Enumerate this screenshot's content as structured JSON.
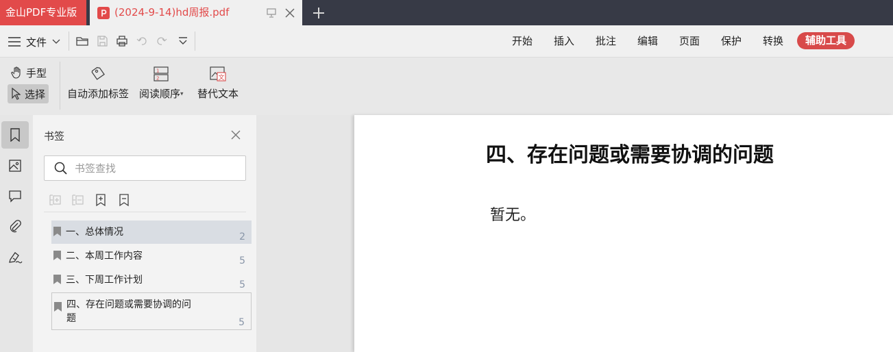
{
  "tabs": {
    "app_label": "金山PDF专业版",
    "document_label": "(2024-9-14)hd周报.pdf"
  },
  "menubar": {
    "file_label": "文件",
    "nav": [
      "开始",
      "插入",
      "批注",
      "编辑",
      "页面",
      "保护",
      "转换"
    ],
    "active_nav": "辅助工具"
  },
  "ribbon": {
    "hand_tool": "手型",
    "select_tool": "选择",
    "auto_tag": "自动添加标签",
    "reading_order": "阅读顺序",
    "alt_text": "替代文本"
  },
  "bookmarks": {
    "title": "书签",
    "search_placeholder": "书签查找",
    "items": [
      {
        "label": "一、总体情况",
        "page": "2"
      },
      {
        "label": "二、本周工作内容",
        "page": "5"
      },
      {
        "label": "三、下周工作计划",
        "page": "5"
      },
      {
        "label": "四、存在问题或需要协调的问题",
        "page": "5"
      }
    ]
  },
  "document": {
    "heading": "四、存在问题或需要协调的问题",
    "body": "暂无。"
  },
  "colors": {
    "accent": "#e24a4a",
    "tabbar": "#373a46",
    "active_nav_bg": "#d84a4a",
    "selected_bookmark_bg": "#d9dde3"
  }
}
